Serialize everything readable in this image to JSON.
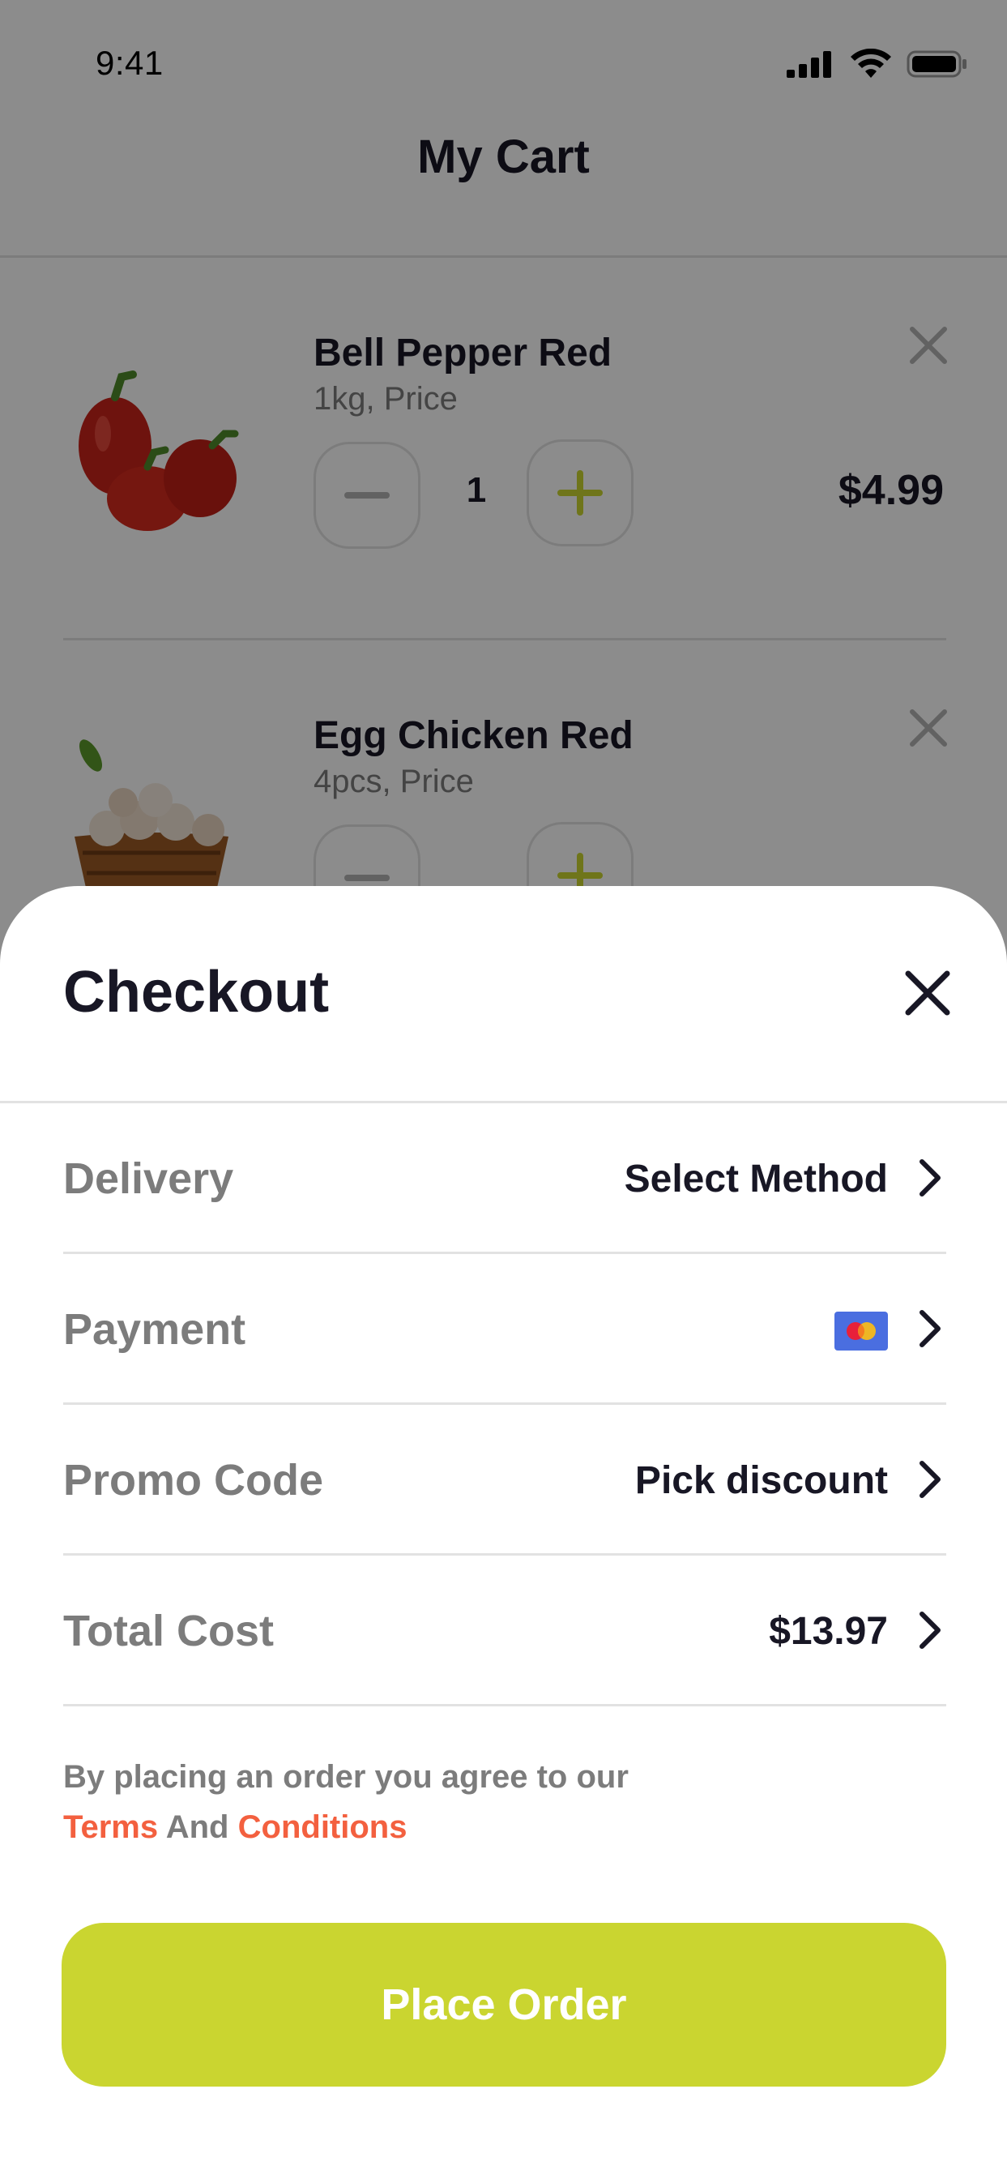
{
  "status_bar": {
    "time": "9:41"
  },
  "page": {
    "title": "My Cart"
  },
  "cart": {
    "items": [
      {
        "name": "Bell Pepper Red",
        "subtitle": "1kg, Price",
        "quantity": "1",
        "price": "$4.99"
      },
      {
        "name": "Egg Chicken Red",
        "subtitle": "4pcs, Price"
      }
    ]
  },
  "checkout": {
    "title": "Checkout",
    "rows": [
      {
        "label": "Delivery",
        "value": "Select Method"
      },
      {
        "label": "Payment",
        "value_icon": "mastercard-icon"
      },
      {
        "label": "Promo Code",
        "value": "Pick discount"
      },
      {
        "label": "Total Cost",
        "value": "$13.97"
      }
    ],
    "terms_prefix": "By placing an order you agree to our",
    "terms_link": "Terms",
    "terms_and": "And",
    "conditions_link": "Conditions",
    "place_order_label": "Place Order"
  },
  "colors": {
    "accent": "#CAD530",
    "link": "#F3603F",
    "text_primary": "#181725",
    "text_secondary": "#7C7C7C",
    "divider": "#E2E2E2"
  }
}
